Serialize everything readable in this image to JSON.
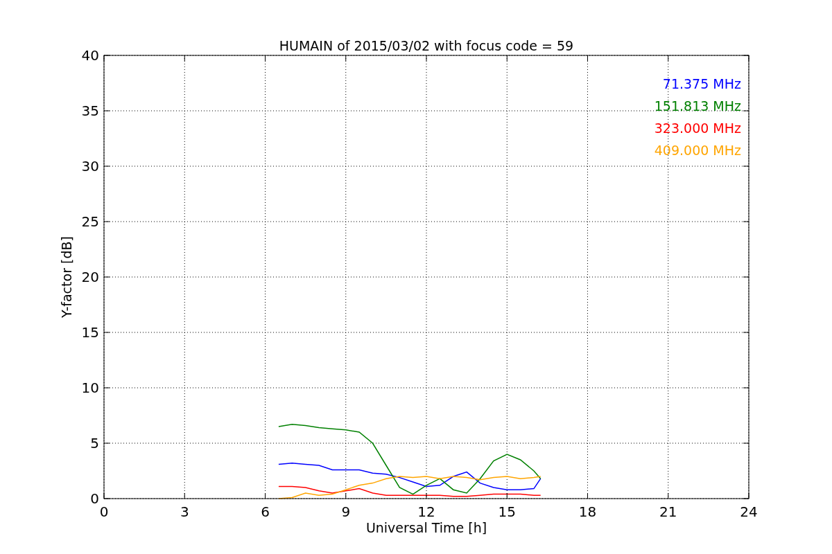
{
  "chart_data": {
    "type": "line",
    "title": "HUMAIN of 2015/03/02 with focus code = 59",
    "xlabel": "Universal Time [h]",
    "ylabel": "Y-factor [dB]",
    "x": [
      6.5,
      7,
      7.5,
      8,
      8.5,
      9,
      9.5,
      10,
      10.5,
      11,
      11.5,
      12,
      12.5,
      13,
      13.5,
      14,
      14.5,
      15,
      15.5,
      16,
      16.25
    ],
    "series": [
      {
        "name": "71.375 MHz",
        "color": "#0000ff",
        "values": [
          3.1,
          3.2,
          3.1,
          3.0,
          2.6,
          2.6,
          2.6,
          2.3,
          2.2,
          1.9,
          1.5,
          1.1,
          1.2,
          2.0,
          2.4,
          1.4,
          1.0,
          0.8,
          0.8,
          0.9,
          1.8
        ]
      },
      {
        "name": "151.813 MHz",
        "color": "#008000",
        "values": [
          6.5,
          6.7,
          6.6,
          6.4,
          6.3,
          6.2,
          6.0,
          5.0,
          3.0,
          1.0,
          0.4,
          1.2,
          1.8,
          0.8,
          0.5,
          1.8,
          3.4,
          4.0,
          3.5,
          2.5,
          1.8
        ]
      },
      {
        "name": "323.000 MHz",
        "color": "#ff0000",
        "values": [
          1.1,
          1.1,
          1.0,
          0.7,
          0.5,
          0.7,
          0.9,
          0.5,
          0.3,
          0.3,
          0.3,
          0.3,
          0.3,
          0.2,
          0.2,
          0.3,
          0.4,
          0.4,
          0.4,
          0.3,
          0.3
        ]
      },
      {
        "name": "409.000 MHz",
        "color": "#ffa500",
        "values": [
          0.0,
          0.1,
          0.5,
          0.3,
          0.4,
          0.8,
          1.2,
          1.4,
          1.8,
          2.0,
          1.9,
          2.0,
          1.8,
          2.0,
          1.9,
          1.7,
          1.9,
          2.0,
          1.8,
          1.9,
          2.0
        ]
      }
    ],
    "grid": true,
    "xlim": [
      0,
      24
    ],
    "ylim": [
      0,
      40
    ],
    "xticks": [
      0,
      3,
      6,
      9,
      12,
      15,
      18,
      21,
      24
    ],
    "yticks": [
      0,
      5,
      10,
      15,
      20,
      25,
      30,
      35,
      40
    ]
  }
}
